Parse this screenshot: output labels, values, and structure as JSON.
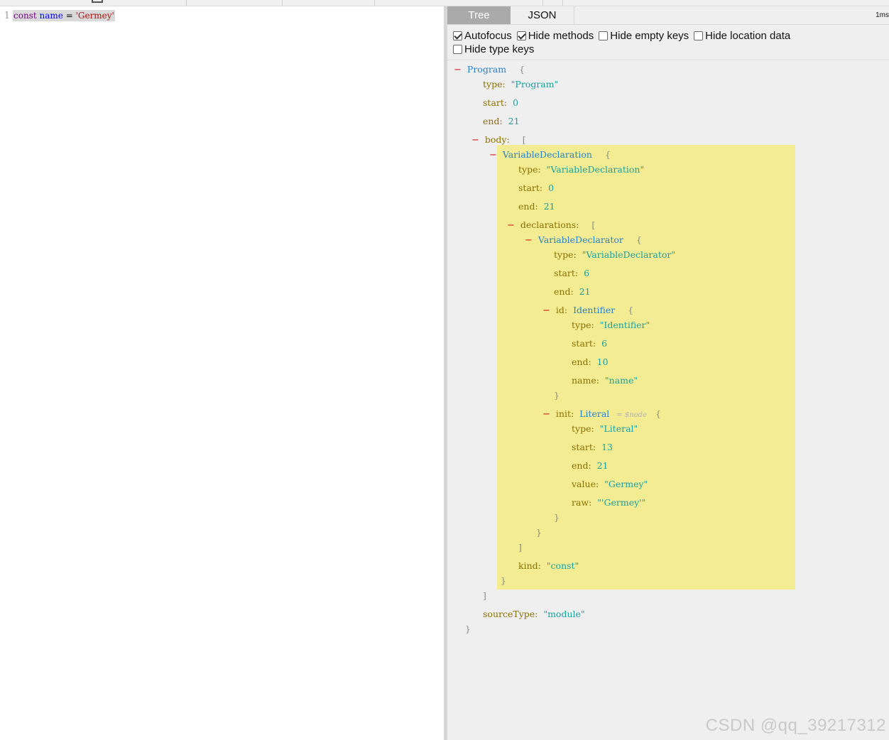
{
  "editor": {
    "line_number": "1",
    "code": {
      "keyword": "const",
      "identifier": "name",
      "operator": "=",
      "string": "'Germey'"
    }
  },
  "panel": {
    "tabs": [
      "Tree",
      "JSON"
    ],
    "active_tab": "Tree",
    "time": "1ms",
    "options": [
      {
        "label": "Autofocus",
        "checked": true
      },
      {
        "label": "Hide methods",
        "checked": true
      },
      {
        "label": "Hide empty keys",
        "checked": false
      },
      {
        "label": "Hide location data",
        "checked": false
      },
      {
        "label": "Hide type keys",
        "checked": false
      }
    ]
  },
  "tree": {
    "program": {
      "label": "Program",
      "type": "\"Program\"",
      "start": "0",
      "end": "21",
      "sourceType": "\"module\""
    },
    "declaration": {
      "label": "VariableDeclaration",
      "type": "\"VariableDeclaration\"",
      "start": "0",
      "end": "21",
      "kind": "\"const\""
    },
    "declarator": {
      "label": "VariableDeclarator",
      "type": "\"VariableDeclarator\"",
      "start": "6",
      "end": "21"
    },
    "id": {
      "label": "Identifier",
      "type": "\"Identifier\"",
      "start": "6",
      "end": "10",
      "name": "\"name\""
    },
    "init": {
      "label": "Literal",
      "hint": "= $node",
      "type": "\"Literal\"",
      "start": "13",
      "end": "21",
      "value": "\"Germey\"",
      "raw": "\"'Germey'\""
    },
    "keys": {
      "type": "type:",
      "start": "start:",
      "end": "end:",
      "body": "body:",
      "declarations": "declarations:",
      "id": "id:",
      "init": "init:",
      "name": "name:",
      "value": "value:",
      "raw": "raw:",
      "kind": "kind:",
      "sourceType": "sourceType:"
    },
    "symbols": {
      "collapse": "−",
      "open_brace": "{",
      "close_brace": "}",
      "open_bracket": "[",
      "close_bracket": "]"
    }
  },
  "watermark": "CSDN @qq_39217312"
}
